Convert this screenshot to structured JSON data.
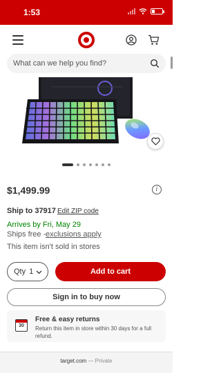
{
  "status_bar": {
    "time": "1:53"
  },
  "header": {
    "search": {
      "placeholder": "What can we help you find?"
    }
  },
  "product": {
    "gallery": {
      "image_count": 7,
      "active_index": 0
    },
    "price": "$1,499.99",
    "shipping": {
      "ship_to_label": "Ship to 37917",
      "edit_zip_label": "Edit ZIP code",
      "arrives_text": "Arrives by Fri, May 29",
      "ships_free_text": "Ships free - ",
      "exclusions_label": "exclusions apply",
      "store_note": "This item isn't sold in stores"
    }
  },
  "actions": {
    "qty_label": "Qty",
    "qty_value": "1",
    "add_to_cart_label": "Add to cart",
    "sign_in_label": "Sign in to buy now"
  },
  "returns": {
    "calendar_day": "30",
    "title": "Free & easy returns",
    "description": "Return this item in store within 30 days for a full refund."
  },
  "browser": {
    "url": "target.com",
    "mode": "Private",
    "separator": " — "
  },
  "colors": {
    "brand_red": "#cc0000",
    "arrival_green": "#008300"
  }
}
